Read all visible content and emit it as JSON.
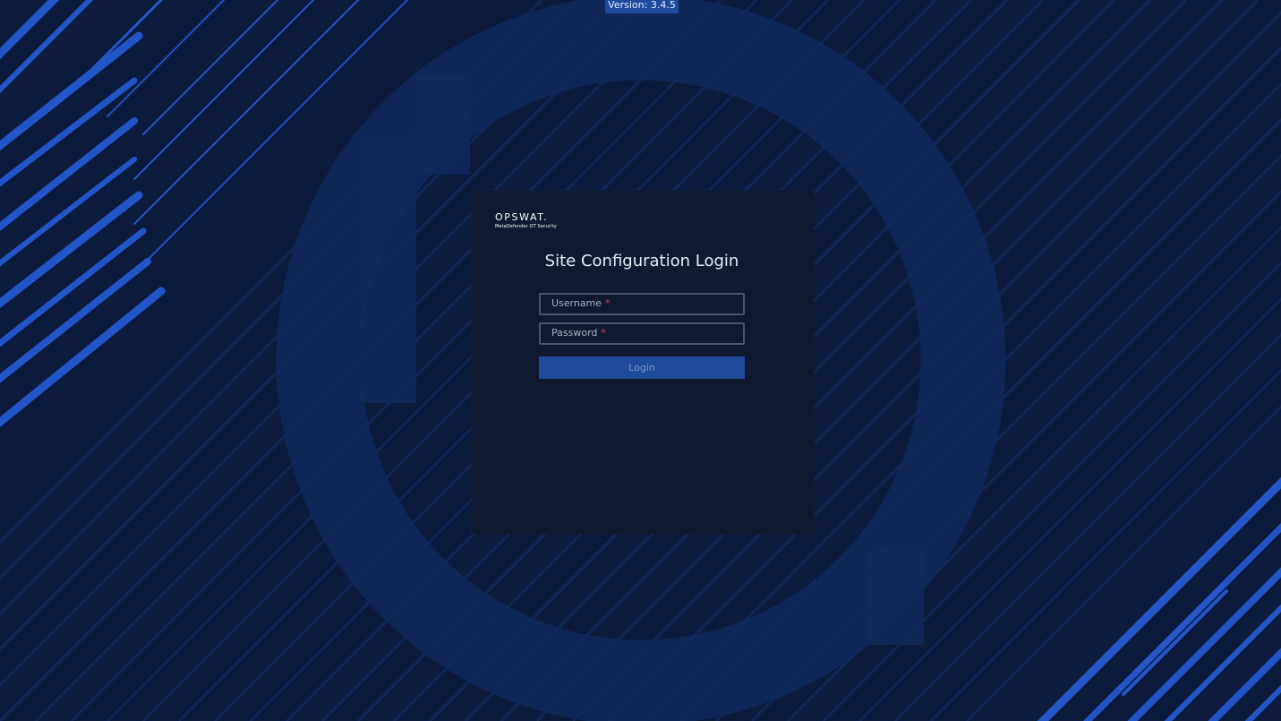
{
  "version": {
    "label": "Version: 3.4.5"
  },
  "logo": {
    "brand": "OPSWAT.",
    "product": "MetaDefender OT Security"
  },
  "login": {
    "title": "Site Configuration Login",
    "username_label": "Username",
    "password_label": "Password",
    "required_marker": "*",
    "submit_label": "Login"
  },
  "colors": {
    "background": "#0c1a3c",
    "card": "#0f1a30",
    "accent": "#1e4b9c",
    "stripe": "#2256c8",
    "required": "#e53e3e"
  }
}
